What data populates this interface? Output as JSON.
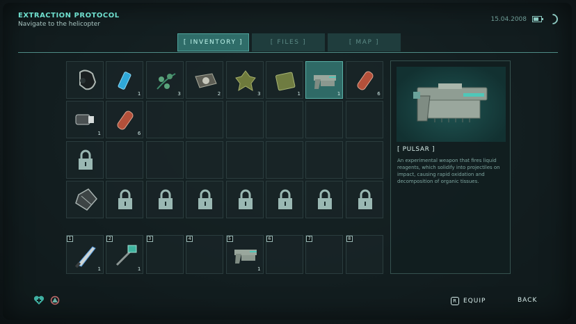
{
  "objective": {
    "title": "EXTRACTION PROTOCOL",
    "subtitle": "Navigate to the helicopter"
  },
  "status": {
    "date": "15.04.2008"
  },
  "tabs": [
    {
      "label": "[ INVENTORY ]",
      "active": true
    },
    {
      "label": "[ FILES ]",
      "active": false
    },
    {
      "label": "[ MAP ]",
      "active": false
    }
  ],
  "inventory": {
    "rows": [
      [
        {
          "icon": "gas-mask-icon",
          "count": ""
        },
        {
          "icon": "lighter-icon",
          "count": "1"
        },
        {
          "icon": "plant-sprig-icon",
          "count": "3"
        },
        {
          "icon": "toolkit-icon",
          "count": "2"
        },
        {
          "icon": "herb-bundle-icon",
          "count": "3"
        },
        {
          "icon": "canister-icon",
          "count": "1"
        },
        {
          "icon": "pulsar-pistol-icon",
          "count": "1",
          "selected": true
        },
        {
          "icon": "ammo-cartridge-icon",
          "count": "6"
        }
      ],
      [
        {
          "icon": "flashlight-icon",
          "count": "1"
        },
        {
          "icon": "ammo-cartridge-icon",
          "count": "6"
        },
        {
          "icon": "",
          "count": ""
        },
        {
          "icon": "",
          "count": ""
        },
        {
          "icon": "",
          "count": ""
        },
        {
          "icon": "",
          "count": ""
        },
        {
          "icon": "",
          "count": ""
        },
        {
          "icon": "",
          "count": ""
        }
      ],
      [
        {
          "icon": "lock-icon",
          "count": ""
        },
        {
          "icon": "",
          "count": ""
        },
        {
          "icon": "",
          "count": ""
        },
        {
          "icon": "",
          "count": ""
        },
        {
          "icon": "",
          "count": ""
        },
        {
          "icon": "",
          "count": ""
        },
        {
          "icon": "",
          "count": ""
        },
        {
          "icon": "",
          "count": ""
        }
      ],
      [
        {
          "icon": "armor-vest-icon",
          "count": ""
        },
        {
          "icon": "lock-icon",
          "count": ""
        },
        {
          "icon": "lock-icon",
          "count": ""
        },
        {
          "icon": "lock-icon",
          "count": ""
        },
        {
          "icon": "lock-icon",
          "count": ""
        },
        {
          "icon": "lock-icon",
          "count": ""
        },
        {
          "icon": "lock-icon",
          "count": ""
        },
        {
          "icon": "lock-icon",
          "count": ""
        }
      ]
    ]
  },
  "hotbar": [
    {
      "num": "1",
      "icon": "knife-icon",
      "count": "1"
    },
    {
      "num": "2",
      "icon": "grabber-tool-icon",
      "count": "1"
    },
    {
      "num": "3",
      "icon": "",
      "count": ""
    },
    {
      "num": "4",
      "icon": "",
      "count": ""
    },
    {
      "num": "5",
      "icon": "pulsar-pistol-icon",
      "count": "1"
    },
    {
      "num": "6",
      "icon": "",
      "count": ""
    },
    {
      "num": "7",
      "icon": "",
      "count": ""
    },
    {
      "num": "8",
      "icon": "",
      "count": ""
    }
  ],
  "detail": {
    "name": "[ PULSAR ]",
    "description": "An experimental weapon that fires liquid reagents, which solidify into projectiles on impact, causing rapid oxidation and decomposition of organic tissues."
  },
  "prompts": {
    "equip_key": "R",
    "equip": "EQUIP",
    "back": "BACK"
  },
  "colors": {
    "accent": "#6fe0cf",
    "active_tab": "#2f6d69",
    "background": "#121b1d"
  }
}
